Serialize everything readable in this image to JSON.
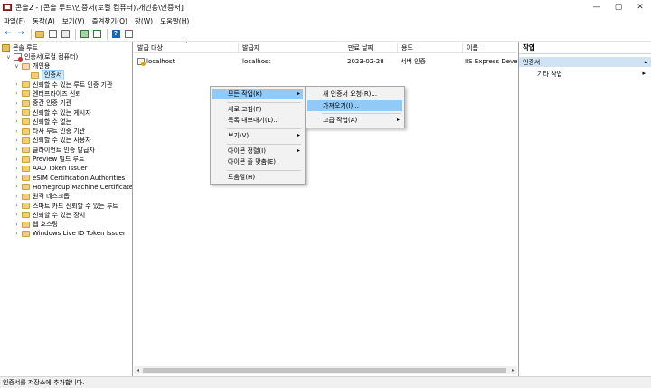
{
  "window": {
    "title": "콘솔2 - [콘솔 루트\\인증서(로컬 컴퓨터)\\개인용\\인증서]",
    "icons": {
      "app": "mmc-console-icon",
      "minimize": "minimize-icon",
      "maximize": "maximize-icon",
      "close": "close-icon"
    }
  },
  "menubar": {
    "items": [
      "파일(F)",
      "동작(A)",
      "보기(V)",
      "즐겨찾기(O)",
      "창(W)",
      "도움말(H)"
    ]
  },
  "toolbar": {
    "buttons": [
      "back-arrow-icon",
      "forward-arrow-icon",
      "up-folder-icon",
      "show-tree-icon",
      "copy-icon",
      "refresh-icon",
      "export-icon",
      "help-icon",
      "properties-icon"
    ]
  },
  "tree": {
    "root": "콘솔 루트",
    "store": "인증서(로컬 컴퓨터)",
    "personal": "개인용",
    "selected": "인증서",
    "folders": [
      "신뢰할 수 있는 루트 인증 기관",
      "엔터프라이즈 신뢰",
      "중간 인증 기관",
      "신뢰할 수 있는 게시자",
      "신뢰할 수 없는",
      "타사 루트 인증 기관",
      "신뢰할 수 있는 사용자",
      "클라이언트 인증 발급자",
      "Preview 빌드 루트",
      "AAD Token Issuer",
      "eSIM Certification Authorities",
      "Homegroup Machine Certificates",
      "원격 데스크톱",
      "스마트 카드 신뢰할 수 있는 루트",
      "신뢰할 수 있는 장치",
      "웹 호스팅",
      "Windows Live ID Token Issuer"
    ]
  },
  "list": {
    "columns": [
      "발급 대상",
      "발급자",
      "만료 날짜",
      "용도",
      "이름"
    ],
    "rows": [
      {
        "issued_to": "localhost",
        "issuer": "localhost",
        "expires": "2023-02-28",
        "purpose": "서버 인증",
        "name": "IIS Express Develop"
      }
    ]
  },
  "actions": {
    "header": "작업",
    "section": "인증서",
    "other": "기타 작업"
  },
  "context_menu": {
    "items": [
      "모든 작업(K)",
      "새로 고침(F)",
      "목록 내보내기(L)...",
      "보기(V)",
      "아이콘 정렬(I)",
      "아이콘 줄 맞춤(E)",
      "도움말(H)"
    ]
  },
  "submenu": {
    "items": [
      "새 인증서 요청(R)...",
      "가져오기(I)...",
      "고급 작업(A)"
    ]
  },
  "status": {
    "text": "인증서를 저장소에 추가합니다."
  },
  "colors": {
    "highlight": "#91c9f7",
    "selection": "#cce8ff",
    "actions_section": "#cfe3f5"
  }
}
